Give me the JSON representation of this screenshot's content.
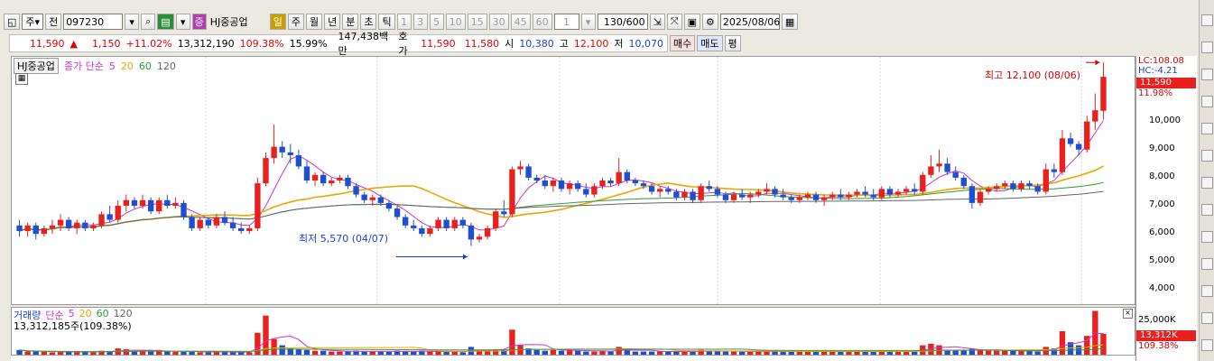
{
  "toolbar": {
    "period_main": "주",
    "prev": "전",
    "code": "097230",
    "name": "HJ중공업",
    "name_tag": "증",
    "periods": [
      "일",
      "주",
      "월",
      "년",
      "분",
      "초",
      "틱"
    ],
    "active_period": "일",
    "minutes": [
      "1",
      "3",
      "5",
      "10",
      "15",
      "30",
      "45",
      "60"
    ],
    "tick_value": "1",
    "count": "130/600",
    "date": "2025/08/06"
  },
  "quote": {
    "price": "11,590",
    "arrow": "▲",
    "change": "1,150",
    "change_pct": "+11.02%",
    "volume": "13,312,190",
    "vol_ratio": "109.38%",
    "turnover": "15.99%",
    "amount": "147,438백만",
    "bid_label": "호가",
    "ask": "11,590",
    "bid": "11,580",
    "open_label": "시",
    "open": "10,380",
    "high_label": "고",
    "high": "12,100",
    "low_label": "저",
    "low": "10,070",
    "buy": "매수",
    "sell": "매도",
    "avg": "평"
  },
  "legend": {
    "name": "HJ중공업",
    "ma_label": "종가 단순",
    "ma": [
      "5",
      "20",
      "60",
      "120"
    ],
    "colors": {
      "ma5": "#cc33cc",
      "ma20": "#e8a800",
      "ma60": "#2e9a3a",
      "ma120": "#666666"
    }
  },
  "axis": {
    "lc": "LC:108.08",
    "hc": "HC:-4.21",
    "current": "11,590",
    "current_pct": "11.98%",
    "ticks": [
      "10,000",
      "9,000",
      "8,000",
      "7,000",
      "6,000",
      "5,000",
      "4,000"
    ]
  },
  "annotations": {
    "high": "최고 12,100 (08/06)",
    "low": "최저 5,570 (04/07)"
  },
  "volume_panel": {
    "title": "거래량",
    "ma_label": "단순",
    "ma": [
      "5",
      "20",
      "60",
      "120"
    ],
    "value": "13,312,185주(109.38%)",
    "tick": "25,000K",
    "current": "13,312K",
    "current_pct": "109.38%"
  },
  "colors": {
    "up": "#e8211f",
    "down": "#1f4fd1",
    "bg": "#ece9e0"
  },
  "chart_data": {
    "type": "candlestick",
    "ylim": [
      3500,
      12300
    ],
    "candles": [
      [
        6300,
        6500,
        5900,
        6100
      ],
      [
        6100,
        6400,
        5900,
        6300
      ],
      [
        6300,
        6400,
        5800,
        6000
      ],
      [
        6000,
        6300,
        5900,
        6200
      ],
      [
        6200,
        6500,
        6000,
        6300
      ],
      [
        6300,
        6700,
        6100,
        6500
      ],
      [
        6500,
        6600,
        6100,
        6200
      ],
      [
        6200,
        6500,
        6000,
        6400
      ],
      [
        6400,
        6500,
        6100,
        6200
      ],
      [
        6200,
        6400,
        6100,
        6300
      ],
      [
        6300,
        6800,
        6200,
        6700
      ],
      [
        6700,
        7000,
        6400,
        6500
      ],
      [
        6500,
        7200,
        6400,
        7000
      ],
      [
        7000,
        7400,
        6800,
        7200
      ],
      [
        7200,
        7300,
        6900,
        7000
      ],
      [
        7000,
        7400,
        6900,
        7200
      ],
      [
        7200,
        7300,
        6700,
        6800
      ],
      [
        6800,
        7300,
        6700,
        7200
      ],
      [
        7200,
        7400,
        6900,
        7000
      ],
      [
        7000,
        7300,
        6900,
        7100
      ],
      [
        7100,
        7200,
        6500,
        6600
      ],
      [
        6600,
        6700,
        6100,
        6200
      ],
      [
        6200,
        6600,
        6100,
        6500
      ],
      [
        6500,
        6600,
        6200,
        6300
      ],
      [
        6300,
        6700,
        6200,
        6600
      ],
      [
        6600,
        6800,
        6300,
        6400
      ],
      [
        6400,
        6600,
        6100,
        6200
      ],
      [
        6200,
        6400,
        6000,
        6100
      ],
      [
        6100,
        6300,
        6000,
        6200
      ],
      [
        6200,
        8000,
        6100,
        7800
      ],
      [
        7800,
        8900,
        7700,
        8700
      ],
      [
        8700,
        9900,
        8500,
        9100
      ],
      [
        9100,
        9300,
        8700,
        8900
      ],
      [
        8900,
        9200,
        8500,
        8800
      ],
      [
        8800,
        9000,
        8300,
        8400
      ],
      [
        8400,
        8600,
        7800,
        7900
      ],
      [
        7900,
        8200,
        7700,
        8100
      ],
      [
        8100,
        8200,
        7700,
        7800
      ],
      [
        7800,
        8000,
        7700,
        7900
      ],
      [
        7900,
        8100,
        7800,
        8000
      ],
      [
        8000,
        8100,
        7600,
        7700
      ],
      [
        7700,
        7800,
        7300,
        7400
      ],
      [
        7400,
        7500,
        7100,
        7200
      ],
      [
        7200,
        7400,
        7000,
        7300
      ],
      [
        7300,
        7400,
        7000,
        7100
      ],
      [
        7100,
        7200,
        6800,
        6900
      ],
      [
        6900,
        7000,
        6500,
        6600
      ],
      [
        6600,
        6700,
        6200,
        6300
      ],
      [
        6300,
        6500,
        6100,
        6200
      ],
      [
        6200,
        6300,
        5900,
        6000
      ],
      [
        6000,
        6300,
        5900,
        6200
      ],
      [
        6200,
        6600,
        6100,
        6500
      ],
      [
        6500,
        6600,
        6100,
        6200
      ],
      [
        6200,
        6600,
        6100,
        6500
      ],
      [
        6500,
        6600,
        6200,
        6300
      ],
      [
        6300,
        6400,
        5570,
        5800
      ],
      [
        5800,
        6000,
        5700,
        5900
      ],
      [
        5900,
        6300,
        5800,
        6200
      ],
      [
        6200,
        6900,
        6100,
        6800
      ],
      [
        6800,
        7200,
        6600,
        6700
      ],
      [
        6700,
        8400,
        6600,
        8300
      ],
      [
        8300,
        8600,
        8100,
        8400
      ],
      [
        8400,
        8500,
        7900,
        8000
      ],
      [
        8000,
        8100,
        7800,
        7900
      ],
      [
        7900,
        8100,
        7600,
        7700
      ],
      [
        7700,
        8000,
        7500,
        7900
      ],
      [
        7900,
        8000,
        7500,
        7600
      ],
      [
        7600,
        7900,
        7400,
        7800
      ],
      [
        7800,
        7900,
        7500,
        7600
      ],
      [
        7600,
        7800,
        7300,
        7400
      ],
      [
        7400,
        7800,
        7300,
        7700
      ],
      [
        7700,
        8000,
        7600,
        7900
      ],
      [
        7900,
        8000,
        7700,
        7800
      ],
      [
        7800,
        8700,
        7700,
        8200
      ],
      [
        8200,
        8300,
        7800,
        7900
      ],
      [
        7900,
        8000,
        7700,
        7800
      ],
      [
        7800,
        7900,
        7600,
        7700
      ],
      [
        7700,
        7800,
        7400,
        7500
      ],
      [
        7500,
        7700,
        7300,
        7600
      ],
      [
        7600,
        7700,
        7400,
        7500
      ],
      [
        7500,
        7600,
        7200,
        7300
      ],
      [
        7300,
        7600,
        7200,
        7500
      ],
      [
        7500,
        7600,
        7100,
        7200
      ],
      [
        7200,
        7800,
        7100,
        7700
      ],
      [
        7700,
        7900,
        7500,
        7600
      ],
      [
        7600,
        7700,
        7300,
        7400
      ],
      [
        7400,
        7500,
        7100,
        7200
      ],
      [
        7200,
        7500,
        7100,
        7400
      ],
      [
        7400,
        7600,
        7200,
        7300
      ],
      [
        7300,
        7500,
        7100,
        7400
      ],
      [
        7400,
        7600,
        7300,
        7500
      ],
      [
        7500,
        7800,
        7400,
        7600
      ],
      [
        7600,
        7700,
        7300,
        7400
      ],
      [
        7400,
        7600,
        7200,
        7300
      ],
      [
        7300,
        7400,
        7100,
        7200
      ],
      [
        7200,
        7400,
        7100,
        7300
      ],
      [
        7300,
        7500,
        7200,
        7400
      ],
      [
        7400,
        7500,
        7100,
        7200
      ],
      [
        7200,
        7400,
        7000,
        7300
      ],
      [
        7300,
        7500,
        7200,
        7400
      ],
      [
        7400,
        7600,
        7200,
        7300
      ],
      [
        7300,
        7500,
        7200,
        7400
      ],
      [
        7400,
        7600,
        7300,
        7500
      ],
      [
        7500,
        7700,
        7300,
        7400
      ],
      [
        7400,
        7600,
        7200,
        7300
      ],
      [
        7300,
        7700,
        7200,
        7600
      ],
      [
        7600,
        7700,
        7300,
        7400
      ],
      [
        7400,
        7600,
        7300,
        7500
      ],
      [
        7500,
        7700,
        7400,
        7600
      ],
      [
        7600,
        7800,
        7400,
        7500
      ],
      [
        7500,
        8200,
        7400,
        8100
      ],
      [
        8100,
        8800,
        8000,
        8400
      ],
      [
        8400,
        9000,
        8200,
        8500
      ],
      [
        8500,
        8700,
        8100,
        8200
      ],
      [
        8200,
        8400,
        7900,
        8000
      ],
      [
        8000,
        8100,
        7600,
        7700
      ],
      [
        7700,
        7800,
        6900,
        7100
      ],
      [
        7100,
        7600,
        7000,
        7500
      ],
      [
        7500,
        7700,
        7400,
        7600
      ],
      [
        7600,
        7800,
        7500,
        7700
      ],
      [
        7700,
        7900,
        7600,
        7800
      ],
      [
        7800,
        7900,
        7500,
        7600
      ],
      [
        7600,
        7900,
        7500,
        7800
      ],
      [
        7800,
        7900,
        7600,
        7700
      ],
      [
        7700,
        7800,
        7400,
        7500
      ],
      [
        7500,
        8500,
        7400,
        8300
      ],
      [
        8300,
        8500,
        8000,
        8200
      ],
      [
        8200,
        9700,
        8100,
        9400
      ],
      [
        9400,
        9600,
        9100,
        9200
      ],
      [
        9200,
        9300,
        8800,
        9000
      ],
      [
        9000,
        10200,
        8900,
        10000
      ],
      [
        10000,
        11000,
        9700,
        10400
      ],
      [
        10380,
        12100,
        10070,
        11590
      ]
    ],
    "volume_k": [
      3000,
      2000,
      2000,
      1800,
      1500,
      2000,
      1800,
      1500,
      2000,
      1500,
      2500,
      2200,
      4000,
      3500,
      2000,
      2500,
      2000,
      3000,
      2000,
      1800,
      1800,
      2000,
      1500,
      1500,
      2000,
      1800,
      1500,
      1500,
      1500,
      14000,
      25000,
      10000,
      6000,
      4000,
      3500,
      3000,
      2500,
      2500,
      2000,
      2000,
      2000,
      2500,
      2000,
      2000,
      2000,
      1800,
      2500,
      2000,
      2000,
      2500,
      2000,
      2000,
      1800,
      2000,
      1500,
      5000,
      3000,
      2500,
      3500,
      3000,
      16000,
      6000,
      4000,
      3000,
      2500,
      3000,
      2500,
      3000,
      2500,
      2000,
      2000,
      2500,
      2000,
      5000,
      3000,
      2000,
      2000,
      2000,
      2000,
      2000,
      2000,
      2000,
      2000,
      3000,
      2500,
      2000,
      2000,
      2000,
      2000,
      2000,
      2000,
      2500,
      2000,
      2000,
      2000,
      2000,
      2000,
      2000,
      2000,
      2000,
      2000,
      2000,
      2000,
      2000,
      2000,
      2500,
      2000,
      2000,
      2000,
      2000,
      6000,
      7000,
      6000,
      3000,
      3000,
      3000,
      4000,
      3000,
      2500,
      2500,
      2500,
      2500,
      2500,
      2500,
      2000,
      5000,
      4000,
      15000,
      8000,
      6000,
      12000,
      28000,
      13312
    ]
  }
}
